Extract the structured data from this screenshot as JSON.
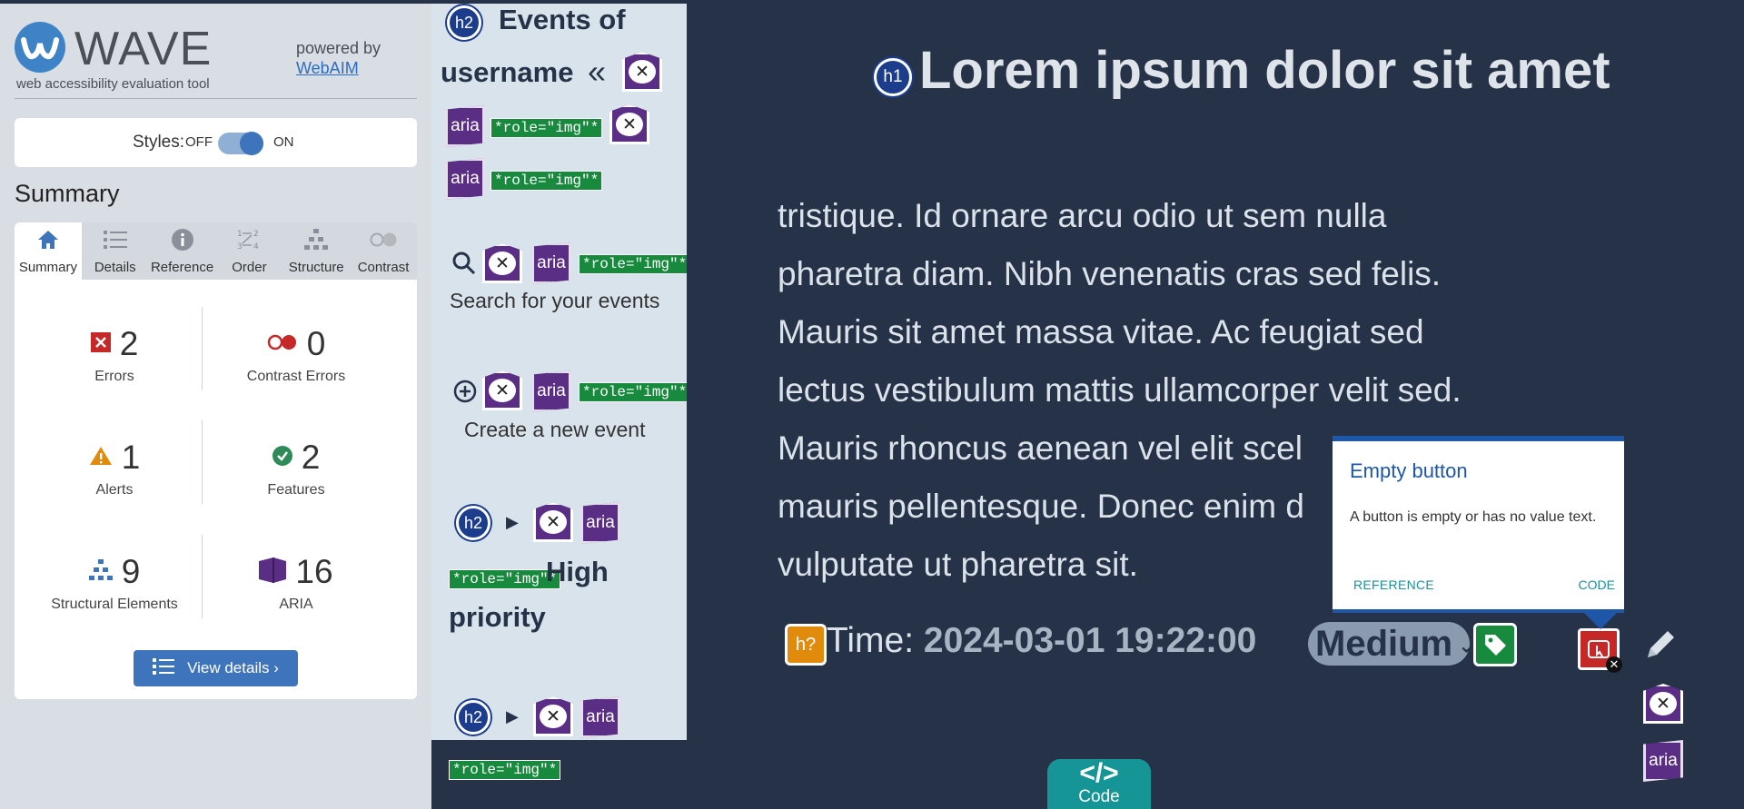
{
  "wave": {
    "title": "WAVE",
    "subtitle": "web accessibility evaluation tool",
    "powered_by": "powered by",
    "powered_link": "WebAIM",
    "styles_label": "Styles:",
    "styles_off": "OFF",
    "styles_on": "ON",
    "summary_heading": "Summary",
    "tabs": [
      {
        "label": "Summary",
        "icon": "home-icon"
      },
      {
        "label": "Details",
        "icon": "list-icon"
      },
      {
        "label": "Reference",
        "icon": "info-icon"
      },
      {
        "label": "Order",
        "icon": "order-icon"
      },
      {
        "label": "Structure",
        "icon": "structure-icon"
      },
      {
        "label": "Contrast",
        "icon": "contrast-icon"
      }
    ],
    "stats": {
      "errors": {
        "count": "2",
        "label": "Errors"
      },
      "contrast_errors": {
        "count": "0",
        "label": "Contrast Errors"
      },
      "alerts": {
        "count": "1",
        "label": "Alerts"
      },
      "features": {
        "count": "2",
        "label": "Features"
      },
      "structural": {
        "count": "9",
        "label": "Structural Elements"
      },
      "aria": {
        "count": "16",
        "label": "ARIA"
      }
    },
    "view_details": "View details ›"
  },
  "events": {
    "heading": "Events of username",
    "heading_line1": "Events of",
    "heading_line2": "username",
    "collapse_glyph": "«",
    "h2_tag": "h2",
    "aria_tag": "aria",
    "role_tag": "*role=\"img\"*",
    "search_label": "Search for your events",
    "create_label": "Create a new event",
    "priority_heading_1": "High",
    "priority_heading_2": "priority"
  },
  "main": {
    "h1_tag": "h1",
    "title": "Lorem ipsum dolor sit amet",
    "paragraph_lines": [
      "tristique. Id ornare arcu odio ut sem nulla",
      "pharetra diam. Nibh venenatis cras sed felis.",
      "Mauris sit amet massa vitae. Ac feugiat sed",
      "lectus vestibulum mattis ullamcorper velit sed.",
      "Mauris rhoncus aenean vel elit scel",
      "mauris pellentesque. Donec enim d",
      "vulputate ut pharetra sit."
    ],
    "h_question": "h?",
    "time_label": "Time:",
    "time_value": "2024-03-01 19:22:00",
    "priority_value": "Medium",
    "code_symbol": "</>",
    "code_label": "Code"
  },
  "popover": {
    "title": "Empty button",
    "body": "A button is empty or has no value text.",
    "reference": "REFERENCE",
    "code": "CODE"
  },
  "colors": {
    "page_bg": "#253247",
    "sidebar_bg": "#d8dee4",
    "wave_blue": "#3d74bc",
    "aria_purple": "#5b2e86",
    "role_green": "#178a3e",
    "code_teal": "#159596",
    "error_red": "#c62828"
  }
}
